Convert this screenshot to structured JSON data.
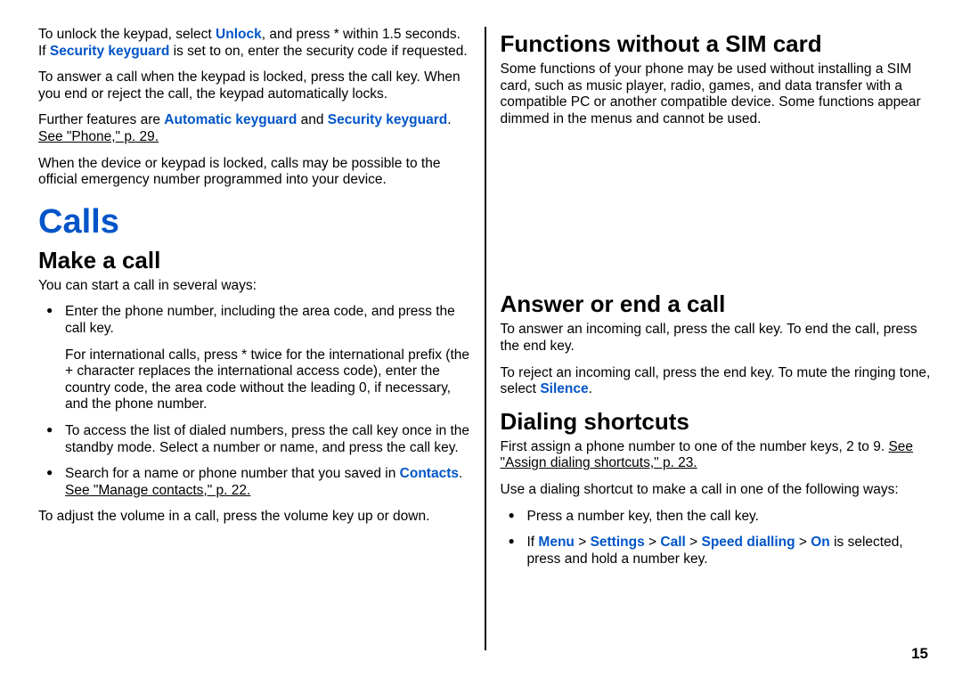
{
  "col1": {
    "p1a": "To unlock the keypad, select ",
    "p1b": "Unlock",
    "p1c": ", and press * within 1.5 seconds. If ",
    "p1d": "Security keyguard",
    "p1e": " is set to on, enter the security code if requested.",
    "p2": "To answer a call when the keypad is locked, press the call key. When you end or reject the call, the keypad automatically locks.",
    "p3a": "Further features are ",
    "p3b": "Automatic keyguard",
    "p3c": " and ",
    "p3d": "Security keyguard",
    "p3e": ". ",
    "p3f": "See \"Phone,\" p. 29.",
    "p4": "When the device or keypad is locked, calls may be possible to the official emergency number programmed into your device.",
    "h1": "Calls",
    "h2a": "Make a call",
    "p5": "You can start a call in several ways:",
    "li1": "Enter the phone number, including the area code, and press the call key.",
    "li1sub": "For international calls, press * twice for the international prefix (the + character replaces the international access code), enter the country code, the area code without the leading 0, if necessary, and the phone number.",
    "li2": "To access the list of dialed numbers, press the call key once in the standby mode. Select a number or name, and press the call key.",
    "li3a": "Search for a name or phone number that you saved in ",
    "li3b": "Contacts",
    "li3c": ". ",
    "li3d": "See \"Manage contacts,\" p. 22.",
    "p6": "To adjust the volume in a call, press the volume key up or down."
  },
  "col2": {
    "h2a": "Functions without a SIM card",
    "p1": "Some functions of your phone may be used without installing a SIM card, such as music player, radio, games, and data transfer with a compatible PC or another compatible device. Some functions appear dimmed in the menus and cannot be used.",
    "h2b": "Answer or end a call",
    "p2": "To answer an incoming call, press the call key. To end the call, press the end key.",
    "p3a": "To reject an incoming call, press the end key. To mute the ringing tone, select ",
    "p3b": "Silence",
    "p3c": ".",
    "h2c": "Dialing shortcuts",
    "p4a": "First assign a phone number to one of the number keys, 2 to 9. ",
    "p4b": "See \"Assign dialing shortcuts,\" p. 23.",
    "p5": "Use a dialing shortcut to make a call in one of the following ways:",
    "li1": "Press a number key, then the call key.",
    "li2a": "If ",
    "li2b": "Menu",
    "li2c": " > ",
    "li2d": "Settings",
    "li2e": " > ",
    "li2f": "Call",
    "li2g": " > ",
    "li2h": "Speed dialling",
    "li2i": " > ",
    "li2j": "On",
    "li2k": " is selected, press and hold a number key."
  },
  "pagenum": "15"
}
